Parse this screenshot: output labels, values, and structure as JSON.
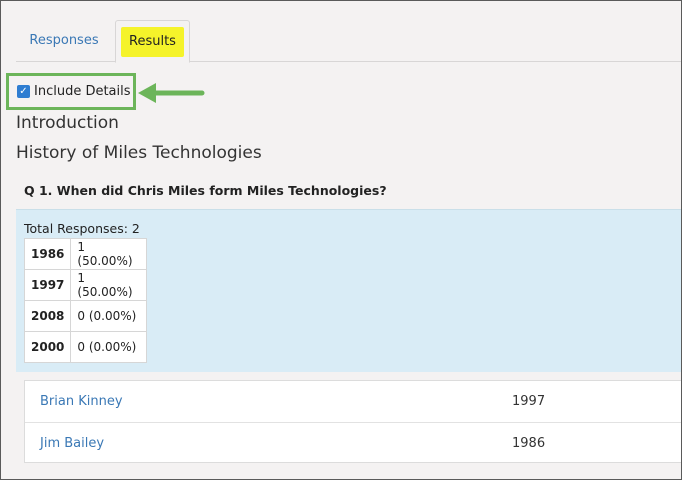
{
  "tabs": {
    "responses": "Responses",
    "results": "Results"
  },
  "include_details": {
    "label": "Include Details",
    "checked": true
  },
  "headings": {
    "section": "Introduction",
    "survey": "History of Miles Technologies"
  },
  "question": {
    "title": "Q 1. When did Chris Miles form Miles Technologies?",
    "total": "Total Responses: 2",
    "options": [
      {
        "year": "1986",
        "value": "1 (50.00%)"
      },
      {
        "year": "1997",
        "value": "1 (50.00%)"
      },
      {
        "year": "2008",
        "value": "0 (0.00%)"
      },
      {
        "year": "2000",
        "value": "0 (0.00%)"
      }
    ]
  },
  "details": [
    {
      "name": "Brian Kinney",
      "answer": "1997"
    },
    {
      "name": "Jim Bailey",
      "answer": "1986"
    }
  ],
  "colors": {
    "highlight_yellow": "#f5f32a",
    "annotation_green": "#6cb55a",
    "link_blue": "#3a78b5",
    "panel_blue": "#d9ecf6"
  }
}
